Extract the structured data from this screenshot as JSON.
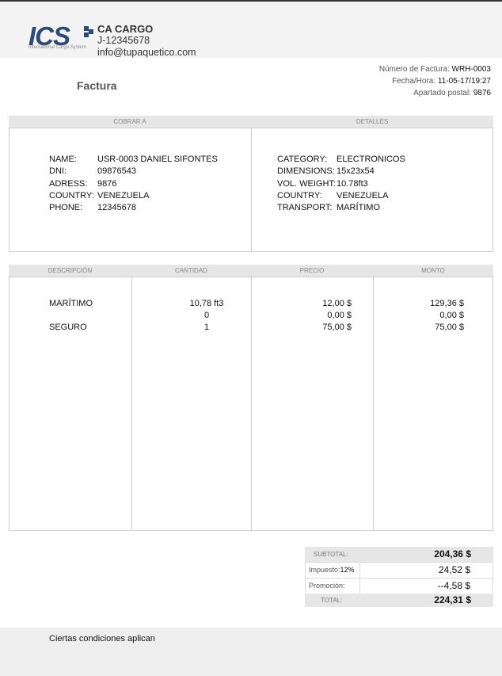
{
  "header": {
    "logo_text": "ICS",
    "logo_tagline": "International Cargo System",
    "company_name": "CA CARGO",
    "company_id": "J-12345678",
    "company_email": "info@tupaquetico.com"
  },
  "invoice": {
    "title": "Factura",
    "number_label": "Número de Factura:",
    "number_value": "WRH-0003",
    "date_label": "Fecha/Hora:",
    "date_value": "11-05-17/19:27",
    "postal_label": "Apartado postal:",
    "postal_value": "9876"
  },
  "billing": {
    "header": "COBRAR A",
    "rows": [
      {
        "k": "NAME:",
        "v": "USR-0003 DANIEL SIFONTES"
      },
      {
        "k": "DNI:",
        "v": "09876543"
      },
      {
        "k": "ADRESS:",
        "v": "9876"
      },
      {
        "k": "COUNTRY:",
        "v": "VENEZUELA"
      },
      {
        "k": "PHONE:",
        "v": "12345678"
      }
    ]
  },
  "details": {
    "header": "DETALLES",
    "rows": [
      {
        "k": "CATEGORY:",
        "v": "ELECTRONICOS"
      },
      {
        "k": "DIMENSIONS:",
        "v": "15x23x54"
      },
      {
        "k": "VOL. WEIGHT:",
        "v": "10.78ft3"
      },
      {
        "k": "COUNTRY:",
        "v": "VENEZUELA"
      },
      {
        "k": "TRANSPORT:",
        "v": "MARÍTIMO"
      }
    ]
  },
  "items": {
    "headers": [
      "DESCRIPCIÓN",
      "CANTIDAD",
      "PRECIO",
      "MONTO"
    ],
    "rows": [
      {
        "desc": "MARÍTIMO",
        "qty": "10,78 ft3",
        "price": "12,00 $",
        "amount": "129,36 $"
      },
      {
        "desc": "",
        "qty": "0",
        "price": "0,00 $",
        "amount": "0,00 $"
      },
      {
        "desc": "SEGURO",
        "qty": "1",
        "price": "75,00 $",
        "amount": "75,00 $"
      }
    ]
  },
  "totals": {
    "subtotal_label": "SUBTOTAL:",
    "subtotal_value": "204,36 $",
    "tax_label": "Impuesto:",
    "tax_rate": "12%",
    "tax_value": "24,52 $",
    "promo_label": "Promoción:",
    "promo_value": "--4,58 $",
    "total_label": "TOTAL:",
    "total_value": "224,31 $"
  },
  "footer": {
    "note": "Ciertas condiciones aplican"
  },
  "colors": {
    "brand": "#2c4a78",
    "header_bg": "#f3f3f3",
    "section_bg": "#e6e6e6"
  }
}
